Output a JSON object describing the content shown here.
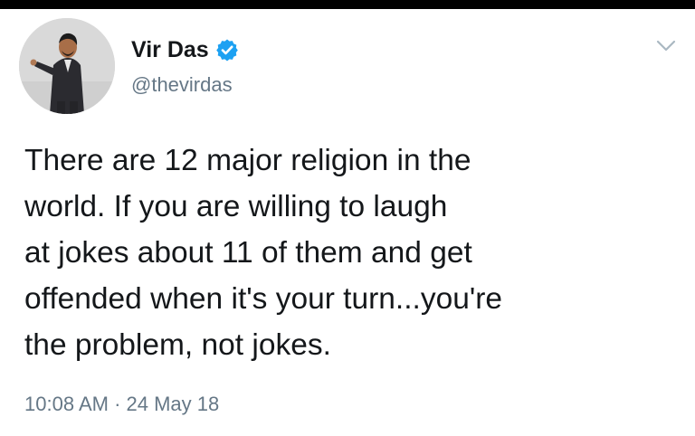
{
  "tweet": {
    "author": {
      "display_name": "Vir Das",
      "handle": "@thevirdas",
      "verified": true,
      "avatar_icon": "profile-photo"
    },
    "text_lines": [
      "There are 12 major religion in the",
      "world. If you are willing to laugh",
      "at jokes about 11 of them and get",
      "offended when it's your turn...you're",
      "the problem, not jokes."
    ],
    "timestamp": "10:08 AM · 24 May 18",
    "menu_icon": "chevron-down-icon"
  },
  "colors": {
    "text": "#14171a",
    "secondary": "#657786",
    "verified_blue": "#1da1f2",
    "top_bar": "#000000"
  }
}
